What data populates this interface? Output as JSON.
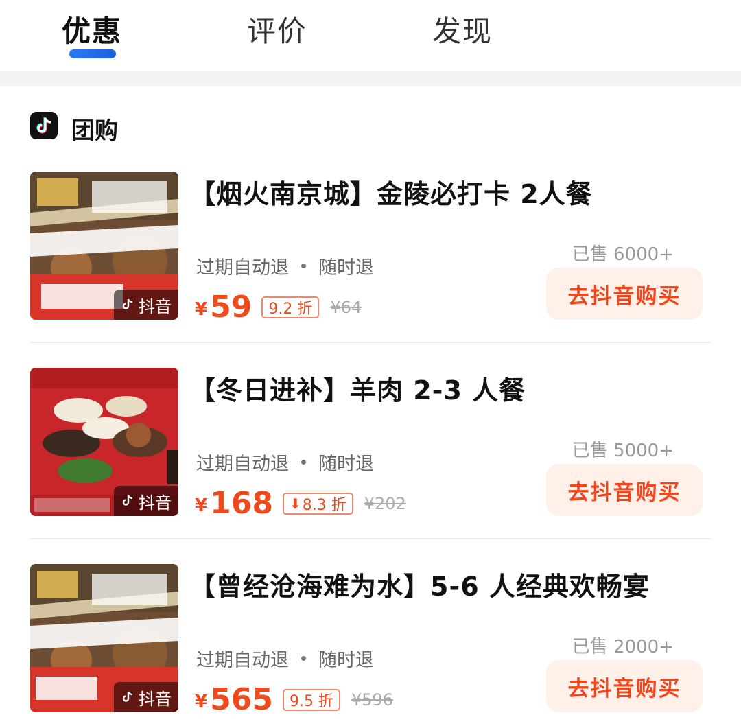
{
  "tabs": [
    {
      "label": "优惠",
      "active": true
    },
    {
      "label": "评价",
      "active": false
    },
    {
      "label": "发现",
      "active": false
    }
  ],
  "section": {
    "icon": "douyin-logo-icon",
    "title": "团购"
  },
  "deals": [
    {
      "title": "【烟火南京城】金陵必打卡 2人餐",
      "tag_1": "过期自动退",
      "tag_2": "随时退",
      "yen": "¥",
      "price": "59",
      "discount": "9.2 折",
      "discount_arrow": false,
      "original_price": "¥64",
      "sold": "已售 6000+",
      "button": "去抖音购买",
      "badge": "抖音",
      "image_theme": "nanjing-poster"
    },
    {
      "title": "【冬日进补】羊肉 2-3 人餐",
      "tag_1": "过期自动退",
      "tag_2": "随时退",
      "yen": "¥",
      "price": "168",
      "discount": "8.3 折",
      "discount_arrow": true,
      "original_price": "¥202",
      "sold": "已售 5000+",
      "button": "去抖音购买",
      "badge": "抖音",
      "image_theme": "hotpot-feast"
    },
    {
      "title": "【曾经沧海难为水】5-6 人经典欢畅宴",
      "tag_1": "过期自动退",
      "tag_2": "随时退",
      "yen": "¥",
      "price": "565",
      "discount": "9.5 折",
      "discount_arrow": false,
      "original_price": "¥596",
      "sold": "已售 2000+",
      "button": "去抖音购买",
      "badge": "抖音",
      "image_theme": "nanjing-poster"
    }
  ],
  "colors": {
    "accent_blue": "#2a79f6",
    "price_red": "#f04a1c",
    "button_bg": "#fff0ea"
  }
}
